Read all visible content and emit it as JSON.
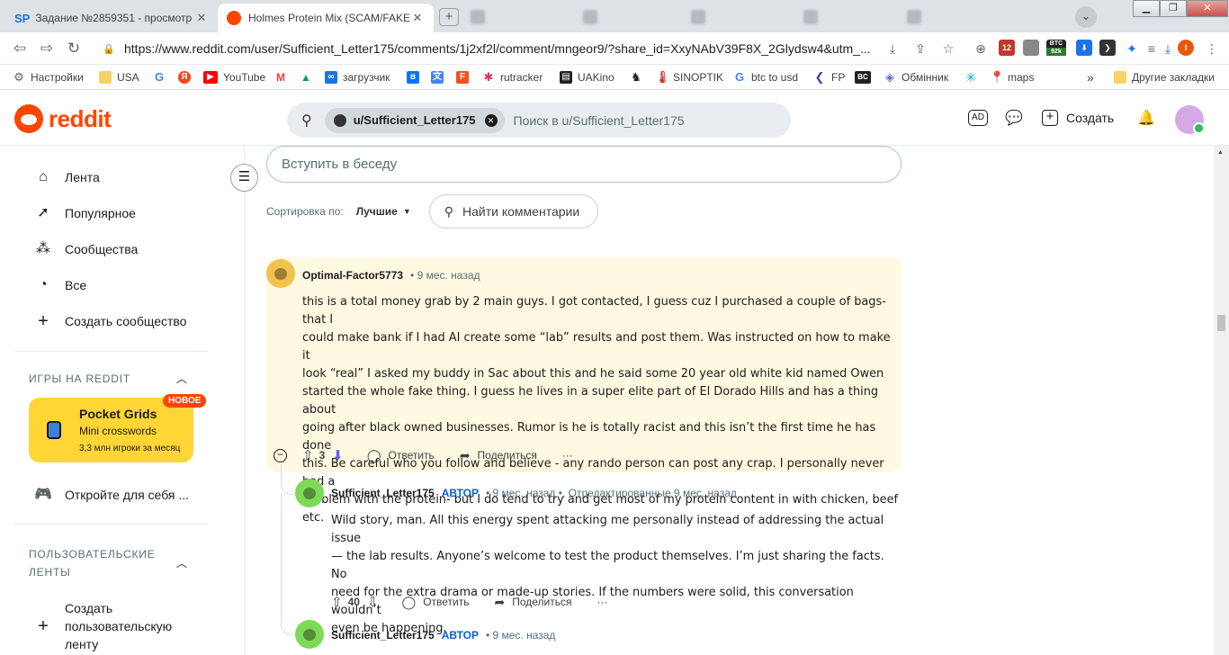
{
  "browser": {
    "tabs": [
      {
        "title": "Задание №2859351 - просмотр з",
        "favicon": "SP"
      },
      {
        "title": "Holmes Protein Mix (SCAM/FAKE M",
        "favicon": "reddit"
      }
    ],
    "url": "https://www.reddit.com/user/Sufficient_Letter175/comments/1j2xf2l/comment/mngeor9/?share_id=XxyNAbV39F8X_2Glydsw4&utm_...",
    "ext_badge_12": "12",
    "ext_btc": "BTC",
    "ext_btc_sub": "92k",
    "profile_letter": "I",
    "bookmarks": [
      "Настройки",
      "USA",
      "YouTube",
      "загрузчик",
      "rutracker",
      "UAKino",
      "SINOPTIK",
      "btc to usd",
      "FP",
      "Обмінник",
      "maps"
    ],
    "bookmarks_more": "»",
    "other_bookmarks": "Другие закладки"
  },
  "header": {
    "logo": "reddit",
    "search_chip": "u/Sufficient_Letter175",
    "search_placeholder": "Поиск в u/Sufficient_Letter175",
    "create_label": "Создать"
  },
  "sidebar": {
    "nav": [
      "Лента",
      "Популярное",
      "Сообщества",
      "Все",
      "Создать сообщество"
    ],
    "games_header": "ИГРЫ НА REDDIT",
    "game": {
      "title": "Pocket Grids",
      "subtitle": "Mini crosswords",
      "players": "3,3 млн игроки за месяц",
      "badge": "НОВОЕ"
    },
    "discover": "Откройте для себя ...",
    "custom_header_1": "ПОЛЬЗОВАТЕЛЬСКИЕ",
    "custom_header_2": "ЛЕНТЫ",
    "create_feed_1": "Создать",
    "create_feed_2": "пользовательскую",
    "create_feed_3": "ленту"
  },
  "main": {
    "join_placeholder": "Вступить в беседу",
    "sort_label": "Сортировка по:",
    "sort_value": "Лучшие",
    "find_comments": "Найти комментарии"
  },
  "comments": [
    {
      "author": "Optimal-Factor5773",
      "time": "• 9 мес. назад",
      "lines": [
        "this is a total money grab by 2 main guys. I got contacted, I guess cuz I purchased a couple of bags- that I",
        "could make bank if I had AI create some “lab” results and post them.  Was instructed on how to make it",
        "look “real”  I asked my buddy in Sac about this and he said some 20 year old white kid named Owen",
        "started the whole fake thing.  I guess he lives in a super elite part of El Dorado Hills and has a thing about",
        "going after black owned businesses.  Rumor is he is totally racist and this isn’t the first time he has done",
        "this.  Be careful who you follow and believe - any rando person can post any crap.  I personally never had a",
        "problem with the protein- but I do tend to try and get most of my protein content in with chicken, beef",
        "etc."
      ],
      "score": "3",
      "reply": "Ответить",
      "share": "Поделиться",
      "more": "···"
    },
    {
      "author": "Sufficient_Letter175",
      "op": "АВТОР",
      "time": "• 9 мес. назад •",
      "edited": ", Отредактированные 9 мес. назад",
      "lines": [
        "Wild story, man. All this energy spent attacking me personally instead of addressing the actual issue",
        "— the lab results. Anyone’s welcome to test the product themselves. I’m just sharing the facts. No",
        "need for the extra drama or made-up stories. If the numbers were solid, this conversation wouldn’t",
        "even be happening."
      ],
      "score": "40",
      "reply": "Ответить",
      "share": "Поделиться",
      "more": "···"
    },
    {
      "author": "Sufficient_Letter175",
      "op": "АВТОР",
      "time": "• 9 мес. назад"
    }
  ]
}
